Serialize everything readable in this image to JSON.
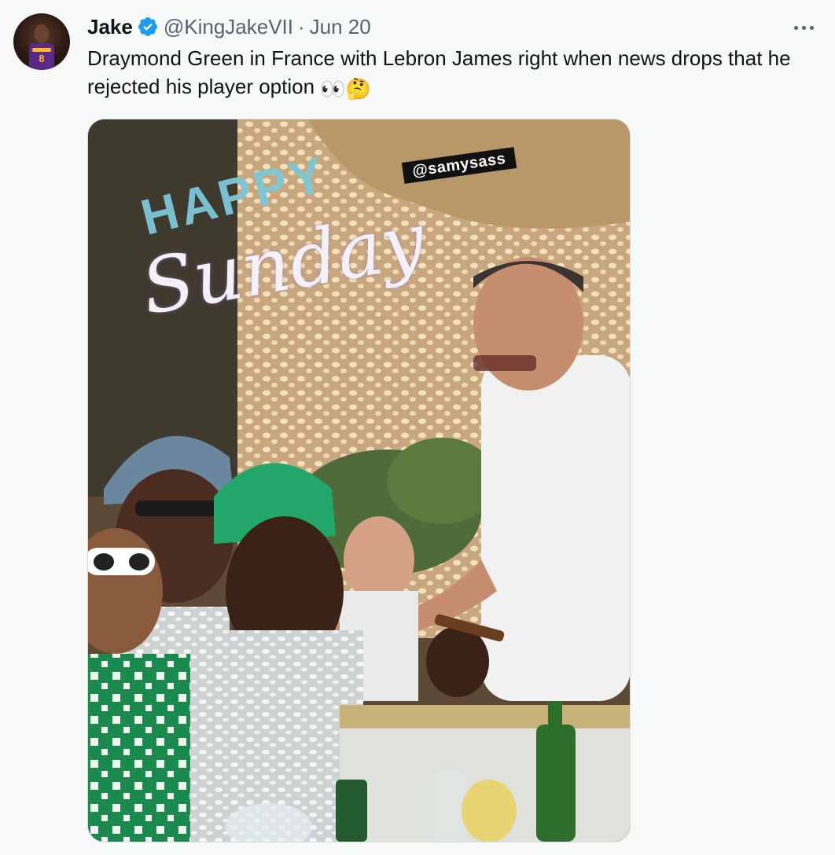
{
  "tweet": {
    "display_name": "Jake",
    "handle": "@KingJakeVII",
    "separator": "·",
    "date": "Jun 20",
    "text": "Draymond Green in France with Lebron James right when news drops that he rejected his player option ",
    "emoji_eyes": "👀",
    "emoji_thinking": "🤔"
  },
  "avatar": {
    "jersey_number": "8"
  },
  "media": {
    "sticker_handle": "@samysass",
    "overlay_word_1": "HAPPY",
    "overlay_word_2": "Sunday"
  },
  "colors": {
    "background": "#f7f9f9",
    "text_primary": "#0f1419",
    "text_secondary": "#536471",
    "verified_blue": "#1d9bf0"
  },
  "icons": {
    "verified": "verified-badge-icon",
    "more": "more-horizontal-icon"
  }
}
